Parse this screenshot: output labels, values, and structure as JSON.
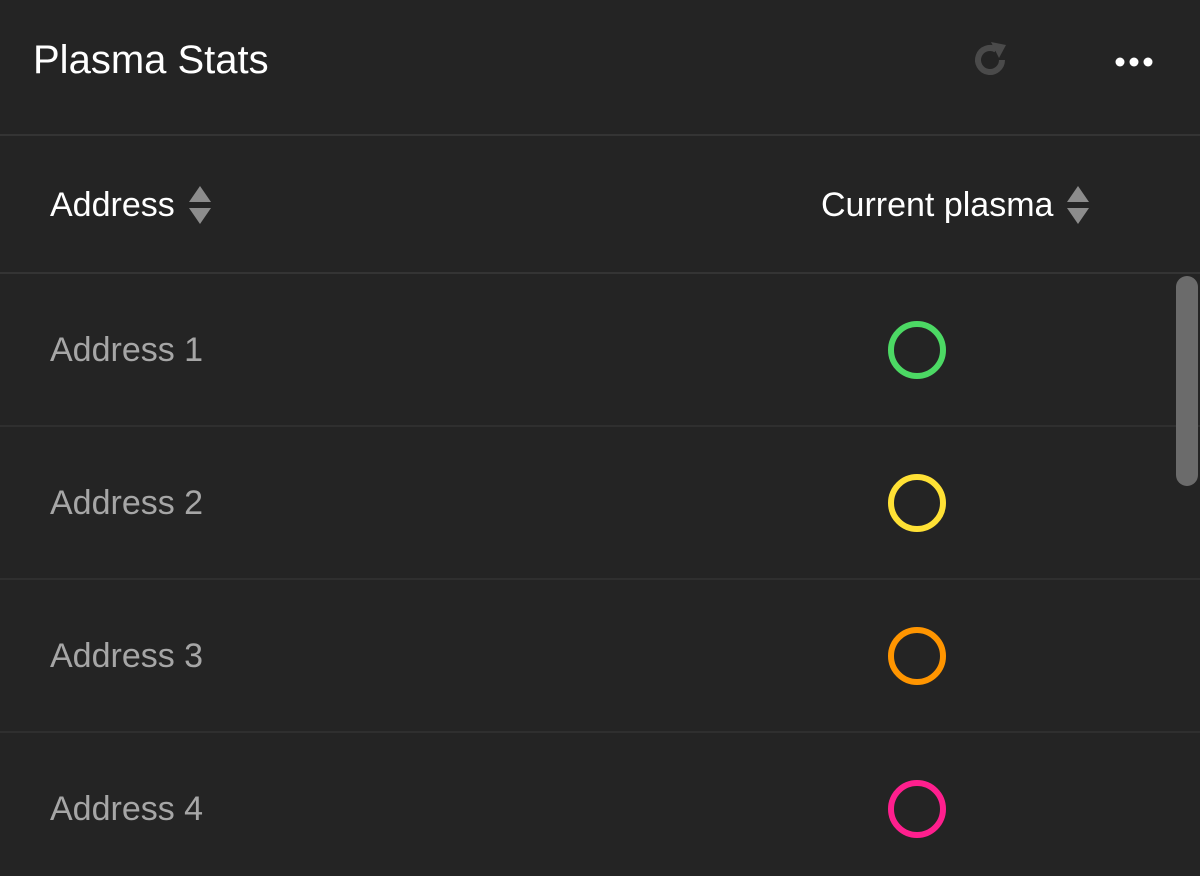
{
  "header": {
    "title": "Plasma Stats",
    "refresh_icon": "refresh-icon",
    "more_icon": "more-horizontal-icon"
  },
  "table": {
    "columns": [
      {
        "label": "Address",
        "sort_icon": "sort-icon"
      },
      {
        "label": "Current plasma",
        "sort_icon": "sort-icon"
      }
    ],
    "rows": [
      {
        "address": "Address 1",
        "status_color": "#4cd964"
      },
      {
        "address": "Address 2",
        "status_color": "#ffe135"
      },
      {
        "address": "Address 3",
        "status_color": "#ff9500"
      },
      {
        "address": "Address 4",
        "status_color": "#ff1f8e"
      }
    ]
  },
  "colors": {
    "background": "#242424",
    "divider": "#343434",
    "title_text": "#ffffff",
    "row_text": "#a6a6a6",
    "refresh_icon": "#4a4a4a",
    "scrollbar_thumb": "#6b6b6b"
  }
}
